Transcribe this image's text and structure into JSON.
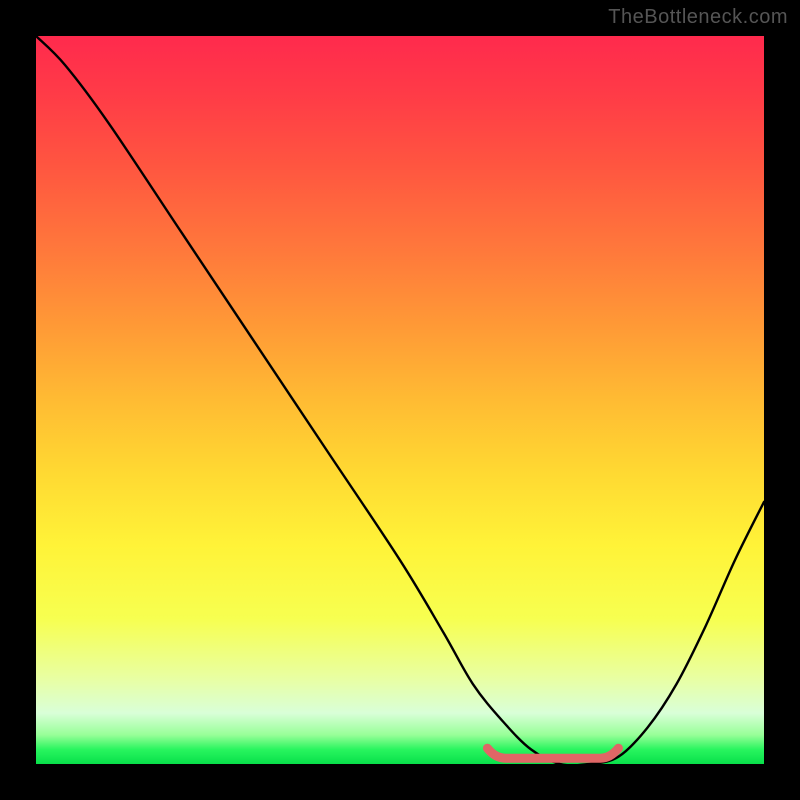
{
  "watermark": "TheBottleneck.com",
  "colors": {
    "frame_background": "#000000",
    "gradient_top": "#ff2a4d",
    "gradient_bottom": "#08e04a",
    "curve_color": "#000000",
    "highlight_color": "#e06666"
  },
  "chart_data": {
    "type": "line",
    "title": "",
    "xlabel": "",
    "ylabel": "",
    "xlim": [
      0,
      100
    ],
    "ylim": [
      0,
      100
    ],
    "grid": false,
    "legend": false,
    "series": [
      {
        "name": "bottleneck-curve",
        "x": [
          0,
          4,
          10,
          20,
          30,
          40,
          50,
          56,
          60,
          64,
          68,
          72,
          76,
          80,
          84,
          88,
          92,
          96,
          100
        ],
        "y": [
          100,
          96,
          88,
          73,
          58,
          43,
          28,
          18,
          11,
          6,
          2,
          0,
          0,
          1,
          5,
          11,
          19,
          28,
          36
        ]
      }
    ],
    "highlight_segment": {
      "description": "Low-bottleneck zone marker near valley floor",
      "x_start": 62,
      "x_end": 80,
      "y": 0.8
    },
    "gradient_meaning": "Vertical color gradient from red (high bottleneck / mismatch) at top to green (balanced / optimal) at bottom."
  }
}
